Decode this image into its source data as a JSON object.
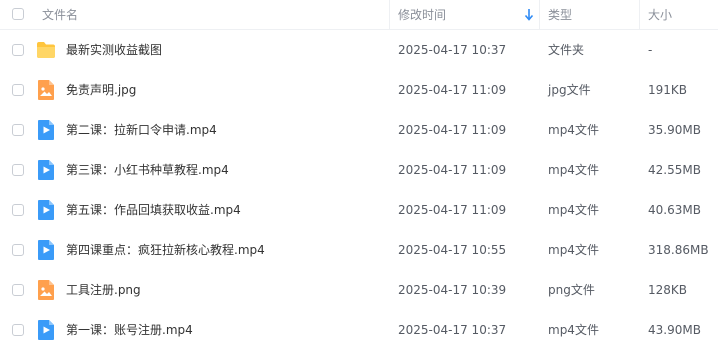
{
  "header": {
    "name_label": "文件名",
    "time_label": "修改时间",
    "type_label": "类型",
    "size_label": "大小",
    "sort_icon": "arrow-down-icon"
  },
  "colors": {
    "folder": "#ffc53d",
    "image": "#ffa04d",
    "video": "#3a9bf8",
    "sort_arrow": "#2f8bf5"
  },
  "files": [
    {
      "name": "最新实测收益截图",
      "time": "2025-04-17 10:37",
      "type": "文件夹",
      "size": "-",
      "icon": "folder-icon"
    },
    {
      "name": "免责声明.jpg",
      "time": "2025-04-17 11:09",
      "type": "jpg文件",
      "size": "191KB",
      "icon": "image-file-icon"
    },
    {
      "name": "第二课：拉新口令申请.mp4",
      "time": "2025-04-17 11:09",
      "type": "mp4文件",
      "size": "35.90MB",
      "icon": "video-file-icon"
    },
    {
      "name": "第三课：小红书种草教程.mp4",
      "time": "2025-04-17 11:09",
      "type": "mp4文件",
      "size": "42.55MB",
      "icon": "video-file-icon"
    },
    {
      "name": "第五课：作品回填获取收益.mp4",
      "time": "2025-04-17 11:09",
      "type": "mp4文件",
      "size": "40.63MB",
      "icon": "video-file-icon"
    },
    {
      "name": "第四课重点：疯狂拉新核心教程.mp4",
      "time": "2025-04-17 10:55",
      "type": "mp4文件",
      "size": "318.86MB",
      "icon": "video-file-icon"
    },
    {
      "name": "工具注册.png",
      "time": "2025-04-17 10:39",
      "type": "png文件",
      "size": "128KB",
      "icon": "image-file-icon"
    },
    {
      "name": "第一课：账号注册.mp4",
      "time": "2025-04-17 10:37",
      "type": "mp4文件",
      "size": "43.90MB",
      "icon": "video-file-icon"
    }
  ]
}
